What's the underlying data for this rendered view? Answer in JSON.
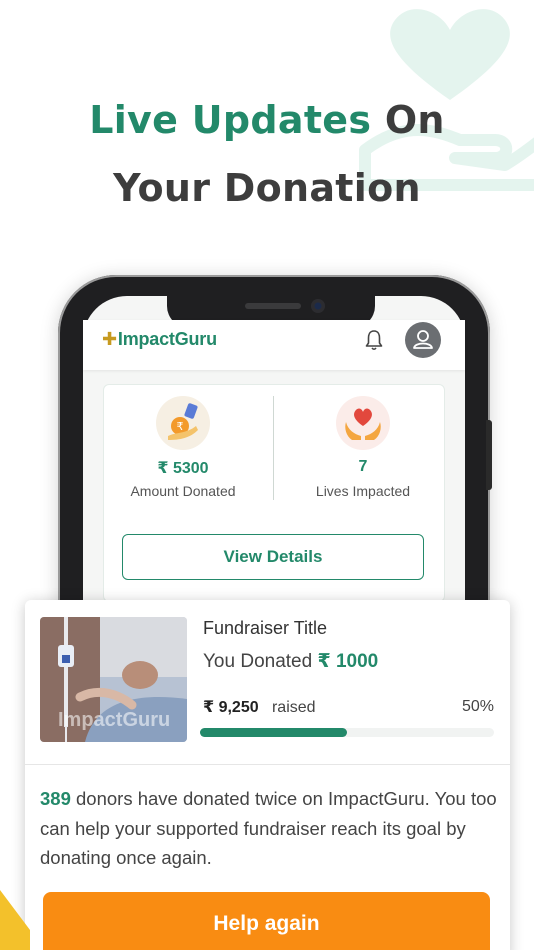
{
  "headline": {
    "highlight": "Live Updates",
    "rest1": "On",
    "line2": "Your Donation"
  },
  "app": {
    "logo": "ImpactGuru",
    "icons": {
      "bell": "bell-icon",
      "profile": "profile-icon",
      "donation": "coin-hand-icon",
      "lives": "heart-hands-icon"
    }
  },
  "stats": {
    "amount_value": "₹ 5300",
    "amount_label": "Amount Donated",
    "lives_value": "7",
    "lives_label": "Lives Impacted",
    "view_details": "View Details"
  },
  "fundraiser": {
    "title": "Fundraiser Title",
    "donated_prefix": "You Donated",
    "donated_amount": "₹ 1000",
    "raised_amount": "₹ 9,250",
    "raised_label": "raised",
    "percent_label": "50%",
    "progress": 0.5,
    "thumb_watermark": "ImpactGuru"
  },
  "message": {
    "count": "389",
    "text": "donors have donated twice on ImpactGuru. You too can help your supported fundraiser reach its goal by donating once again."
  },
  "help_button": "Help again",
  "colors": {
    "brand_green": "#23896a",
    "cta_orange": "#f98c12"
  }
}
